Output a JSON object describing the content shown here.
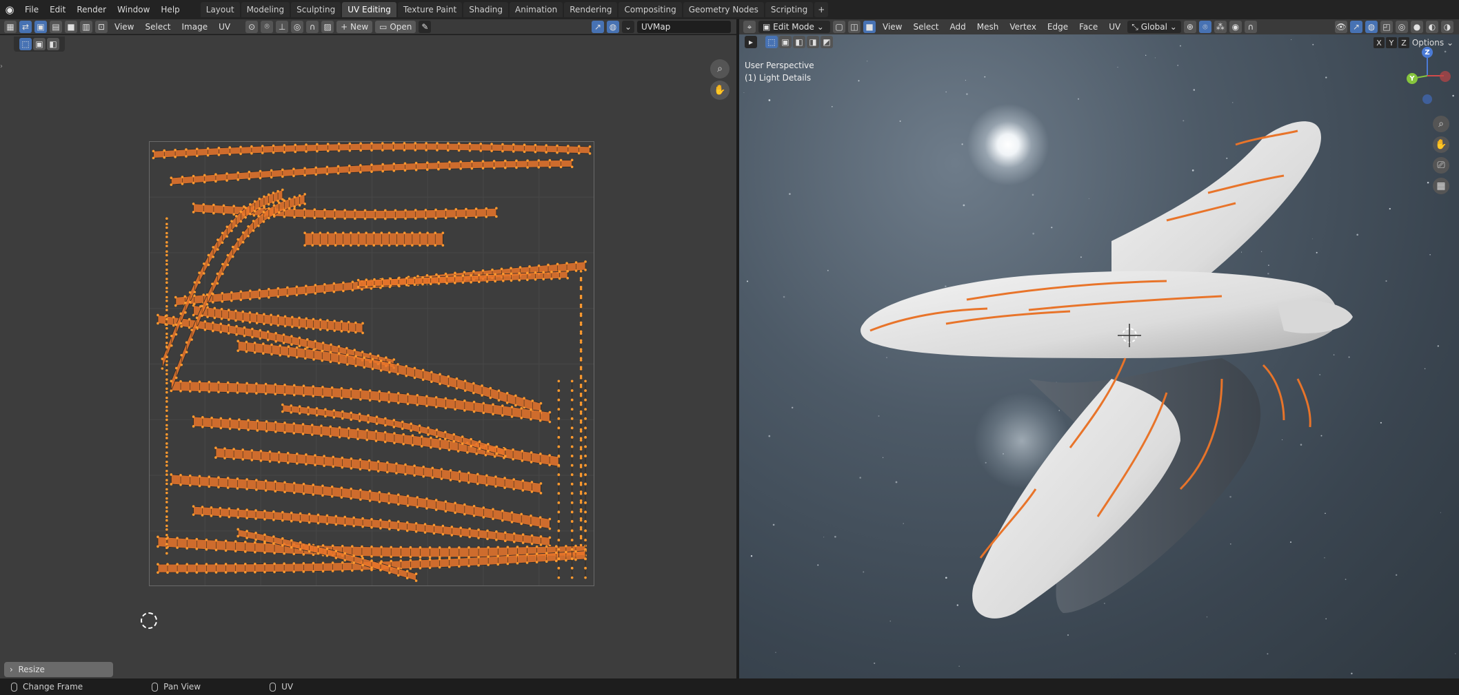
{
  "menu": [
    "File",
    "Edit",
    "Render",
    "Window",
    "Help"
  ],
  "tabs": [
    "Layout",
    "Modeling",
    "Sculpting",
    "UV Editing",
    "Texture Paint",
    "Shading",
    "Animation",
    "Rendering",
    "Compositing",
    "Geometry Nodes",
    "Scripting"
  ],
  "active_tab": "UV Editing",
  "uv_editor": {
    "menus": [
      "View",
      "Select",
      "Image",
      "UV"
    ],
    "new_label": "New",
    "open_label": "Open",
    "uvmap_field": "UVMap",
    "redo_panel": "Resize"
  },
  "viewport": {
    "mode": "Edit Mode",
    "menus": [
      "View",
      "Select",
      "Add",
      "Mesh",
      "Vertex",
      "Edge",
      "Face",
      "UV"
    ],
    "orientation": "Global",
    "overlay_line1": "User Perspective",
    "overlay_line2": "(1) Light Details",
    "axis_buttons": [
      "X",
      "Y",
      "Z"
    ],
    "options_label": "Options",
    "gizmo": {
      "z": "Z",
      "y": "Y"
    }
  },
  "status": {
    "left": "Change Frame",
    "middle": "Pan View",
    "right": "UV"
  },
  "colors": {
    "accent": "#4772b3",
    "uv_orange": "#e8742a",
    "vertex": "#ff9a2e"
  }
}
